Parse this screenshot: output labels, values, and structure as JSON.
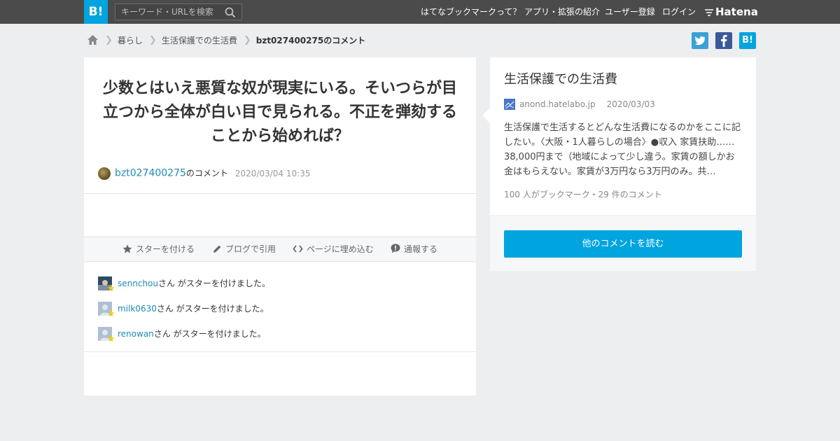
{
  "header": {
    "logo_text": "B!",
    "search_placeholder": "キーワード・URLを検索",
    "nav": [
      "はてなブックマークって？",
      "アプリ・拡張の紹介",
      "ユーザー登録",
      "ログイン"
    ],
    "brand": "Hatena"
  },
  "breadcrumb": {
    "items": [
      "暮らし",
      "生活保護での生活費"
    ],
    "current": "bzt027400275のコメント"
  },
  "share": {
    "twitter": "t",
    "facebook": "f",
    "hatena": "B!"
  },
  "comment": {
    "text": "少数とはいえ悪質な奴が現実にいる。そいつらが目立つから全体が白い目で見られる。不正を弾劾することから始めれば？",
    "user": "bzt027400275",
    "suffix": "のコメント",
    "date": "2020/03/04 10:35"
  },
  "actions": [
    "スターを付ける",
    "ブログで引用",
    "ページに埋め込む",
    "通報する"
  ],
  "stars": [
    {
      "user": "sennchou",
      "text": "さん がスターを付けました。"
    },
    {
      "user": "milk0630",
      "text": "さん がスターを付けました。"
    },
    {
      "user": "renowan",
      "text": "さん がスターを付けました。"
    }
  ],
  "entry": {
    "title": "生活保護での生活費",
    "domain": "anond.hatelabo.jp",
    "date": "2020/03/03",
    "description": "生活保護で生活するとどんな生活費になるのかをここに記したい。〈大阪・1人暮らしの場合〉●収入 家賃扶助……38,000円まで（地域によって少し違う。家賃の額しかお金はもらえない。家賃が3万円なら3万円のみ。共…",
    "count": "100 人がブックマーク・29 件のコメント",
    "button": "他のコメントを読む"
  },
  "colors": {
    "accent": "#00a4de",
    "topbar": "#4b4b4b",
    "link": "#1e8bb5",
    "twitter": "#3aa0d8",
    "facebook": "#3b5998"
  }
}
